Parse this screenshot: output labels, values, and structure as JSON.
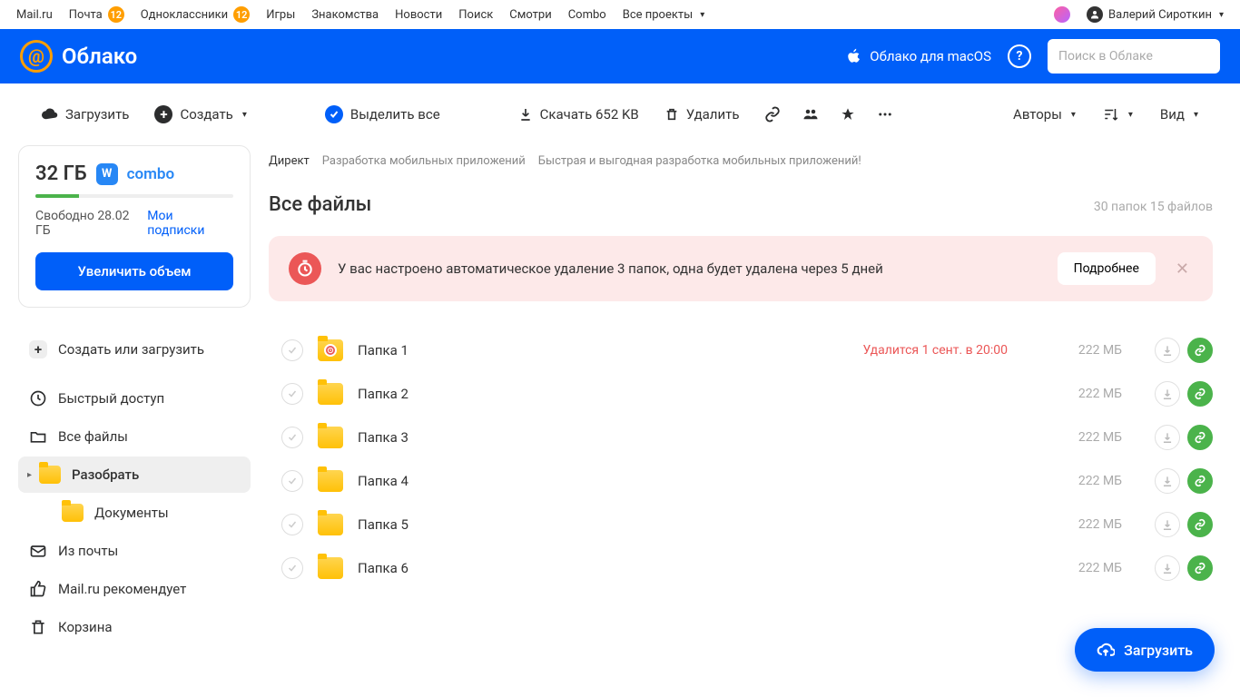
{
  "topnav": {
    "left": [
      {
        "label": "Mail.ru"
      },
      {
        "label": "Почта",
        "badge": "12"
      },
      {
        "label": "Одноклассники",
        "badge": "12"
      },
      {
        "label": "Игры"
      },
      {
        "label": "Знакомства"
      },
      {
        "label": "Новости"
      },
      {
        "label": "Поиск"
      },
      {
        "label": "Смотри"
      },
      {
        "label": "Combo"
      },
      {
        "label": "Все проекты",
        "chev": true
      }
    ],
    "user": "Валерий Сироткин"
  },
  "header": {
    "logo_text": "Облако",
    "macos": "Облако для macOS",
    "search_placeholder": "Поиск в Облаке"
  },
  "toolbar": {
    "upload": "Загрузить",
    "create": "Создать",
    "select_all": "Выделить все",
    "download": "Скачать 652 KB",
    "delete": "Удалить",
    "authors": "Авторы",
    "view": "Вид"
  },
  "storage": {
    "size": "32 ГБ",
    "combo": "combo",
    "free": "Свободно 28.02 ГБ",
    "subs": "Мои подписки",
    "upgrade": "Увеличить объем"
  },
  "nav": {
    "create": "Создать или загрузить",
    "quick": "Быстрый доступ",
    "all": "Все файлы",
    "sort": "Разобрать",
    "docs": "Документы",
    "mail": "Из почты",
    "rec": "Mail.ru рекомендует",
    "trash": "Корзина"
  },
  "direkt": {
    "label": "Директ",
    "t1": "Разработка мобильных приложений",
    "t2": "Быстрая и выгодная разработка мобильных приложений!"
  },
  "heading": {
    "title": "Все файлы",
    "count": "30 папок 15 файлов"
  },
  "notice": {
    "text": "У вас настроено автоматическое удаление 3 папок, одна будет удалена через 5 дней",
    "more": "Подробнее"
  },
  "files": [
    {
      "name": "Папка 1",
      "size": "222 МБ",
      "del": "Удалится 1 сент. в 20:00",
      "timer": true
    },
    {
      "name": "Папка 2",
      "size": "222 МБ"
    },
    {
      "name": "Папка 3",
      "size": "222 МБ"
    },
    {
      "name": "Папка 4",
      "size": "222 МБ"
    },
    {
      "name": "Папка 5",
      "size": "222 МБ"
    },
    {
      "name": "Папка 6",
      "size": "222 МБ"
    }
  ],
  "float": "Загрузить"
}
